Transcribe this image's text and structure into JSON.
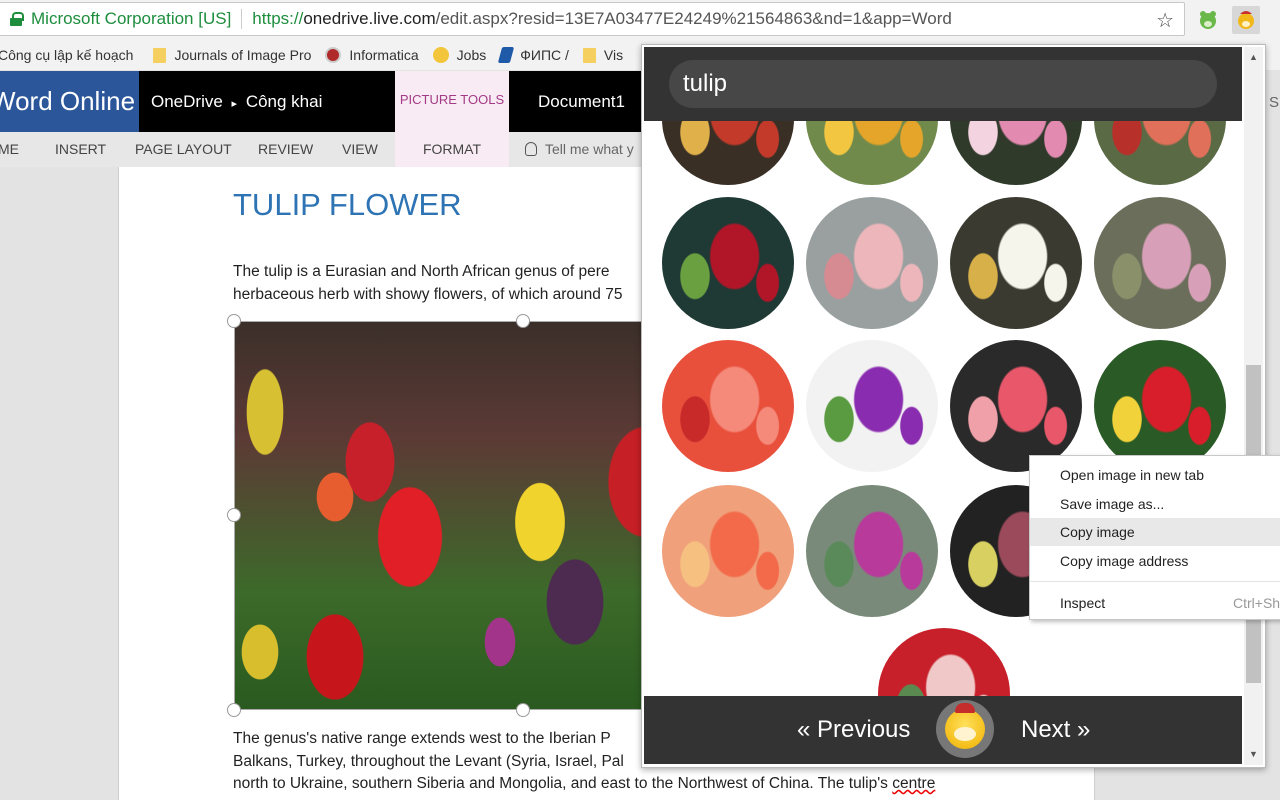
{
  "browser": {
    "security_org": "Microsoft Corporation [US]",
    "url_scheme": "https://",
    "url_domain": "onedrive.live.com",
    "url_rest": "/edit.aspx?resid=13E7A03477E24249%21564863&nd=1&app=Word",
    "bookmark_star_icon": "star-icon",
    "extensions": [
      {
        "name": "green-bear-extension"
      },
      {
        "name": "yellow-bear-extension"
      }
    ],
    "bookmarks": [
      {
        "label": "Công cụ lập kế hoạch",
        "icon": "none"
      },
      {
        "label": "Journals of Image Pro",
        "icon": "folder-icon"
      },
      {
        "label": "Informatica",
        "icon": "site-icon"
      },
      {
        "label": "Jobs",
        "icon": "site-icon"
      },
      {
        "label": "ФИПС /",
        "icon": "site-icon"
      },
      {
        "label": "Vis",
        "icon": "folder-icon"
      }
    ]
  },
  "word": {
    "app_name": "Word Online",
    "breadcrumb_root": "OneDrive",
    "breadcrumb_sep": "▸",
    "breadcrumb_folder": "Công khai",
    "contextual_group": "PICTURE TOOLS",
    "document_name": "Document1",
    "ribbon_tabs": [
      "ME",
      "INSERT",
      "PAGE LAYOUT",
      "REVIEW",
      "VIEW",
      "FORMAT"
    ],
    "tell_me": "Tell me what y"
  },
  "document": {
    "title": "TULIP FLOWER",
    "para1": [
      "The tulip is a Eurasian and North African genus of pere",
      "herbaceous herb with showy flowers, of which around 75"
    ],
    "para2": [
      "The genus's native range extends west to the Iberian P",
      "Balkans, Turkey, throughout the Levant (Syria, Israel, Pal",
      "north to Ukraine, southern Siberia and Mongolia, and east to the Northwest of China. The tulip's "
    ],
    "misspelled_word": "centre"
  },
  "popup": {
    "search_query": "tulip",
    "prev_label": "« Previous",
    "next_label": "Next »",
    "mascot_icon": "bear-mascot-icon",
    "thumbnails": [
      {
        "desc": "red-yellow tulips",
        "colors": [
          "#3a2f25",
          "#c43a2a",
          "#e0b04a"
        ]
      },
      {
        "desc": "yellow tulip",
        "colors": [
          "#6f8a4a",
          "#e5a52a",
          "#f2c640"
        ]
      },
      {
        "desc": "pink tulips",
        "colors": [
          "#2f3a2a",
          "#e28ab0",
          "#f3d3e0"
        ]
      },
      {
        "desc": "coral tulip",
        "colors": [
          "#5a6a45",
          "#e0705a",
          "#b8302a"
        ]
      },
      {
        "desc": "red tulips on dark",
        "colors": [
          "#1f3a35",
          "#b01528",
          "#6aa040"
        ]
      },
      {
        "desc": "pink tulip closeup",
        "colors": [
          "#9aa0a0",
          "#ecb6ba",
          "#d68a92"
        ]
      },
      {
        "desc": "white tulips",
        "colors": [
          "#3a3a30",
          "#f5f5ec",
          "#d8b04a"
        ]
      },
      {
        "desc": "pink tulip field",
        "colors": [
          "#6a6e5a",
          "#d8a0b8",
          "#8a906a"
        ]
      },
      {
        "desc": "red tulips blur",
        "colors": [
          "#e8503c",
          "#f58a7a",
          "#c82a2a"
        ]
      },
      {
        "desc": "purple tulip",
        "colors": [
          "#f2f2f2",
          "#8a2cb0",
          "#5a9a40"
        ]
      },
      {
        "desc": "pink tulip on black",
        "colors": [
          "#2a2a2a",
          "#e8586a",
          "#f0a0a8"
        ]
      },
      {
        "desc": "mixed tulips",
        "colors": [
          "#2a5a25",
          "#d81e2a",
          "#f2d23a"
        ]
      },
      {
        "desc": "orange tulip field",
        "colors": [
          "#f0a07a",
          "#f26a4a",
          "#f5c080"
        ]
      },
      {
        "desc": "magenta tulips",
        "colors": [
          "#7a8a7a",
          "#b83a9a",
          "#5a8a5a"
        ]
      },
      {
        "desc": "dark red tulip",
        "colors": [
          "#222222",
          "#9a4a5a",
          "#d8d060"
        ]
      },
      {
        "desc": "red white tulip field",
        "colors": [
          "#c8202a",
          "#f0c8c8",
          "#5a8a50"
        ]
      }
    ]
  },
  "context_menu": {
    "items": [
      {
        "label": "Open image in new tab",
        "shortcut": ""
      },
      {
        "label": "Save image as...",
        "shortcut": ""
      },
      {
        "label": "Copy image",
        "shortcut": "",
        "highlighted": true
      },
      {
        "label": "Copy image address",
        "shortcut": ""
      },
      {
        "label": "Inspect",
        "shortcut": "Ctrl+Sh"
      }
    ]
  },
  "right_pane_peek": "S"
}
